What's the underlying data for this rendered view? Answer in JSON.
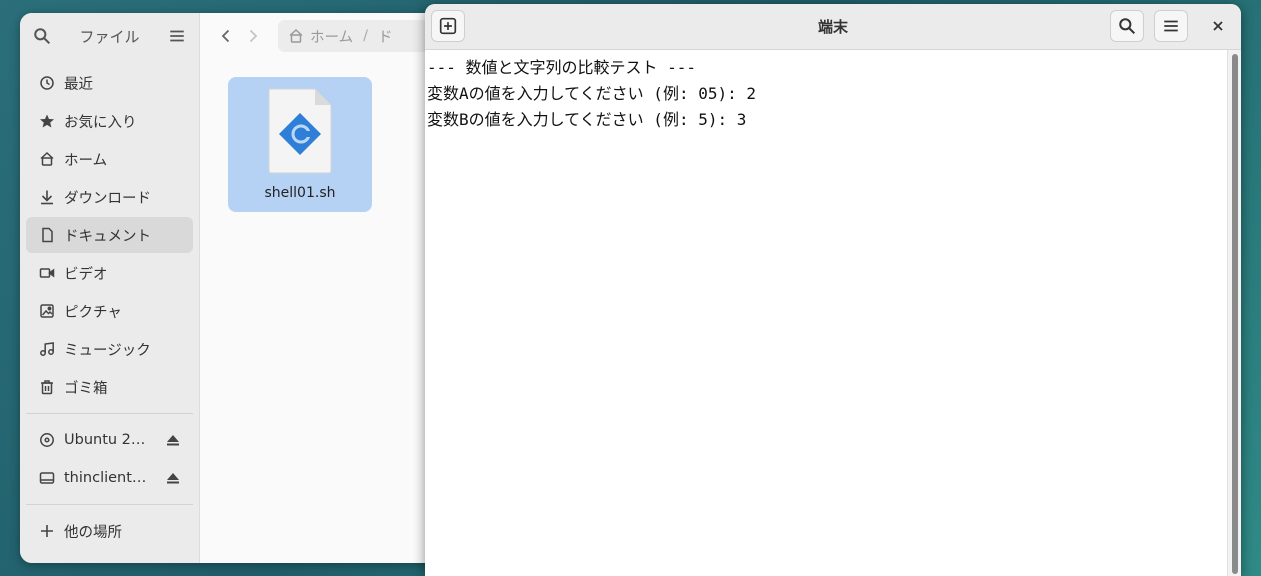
{
  "file_manager": {
    "sidebar_title": "ファイル",
    "places": [
      {
        "label": "最近",
        "icon": "clock-icon"
      },
      {
        "label": "お気に入り",
        "icon": "star-icon"
      },
      {
        "label": "ホーム",
        "icon": "home-icon"
      },
      {
        "label": "ダウンロード",
        "icon": "download-icon"
      },
      {
        "label": "ドキュメント",
        "icon": "document-icon",
        "active": true
      },
      {
        "label": "ビデオ",
        "icon": "video-icon"
      },
      {
        "label": "ピクチャ",
        "icon": "picture-icon"
      },
      {
        "label": "ミュージック",
        "icon": "music-icon"
      },
      {
        "label": "ゴミ箱",
        "icon": "trash-icon"
      }
    ],
    "devices": [
      {
        "label": "Ubuntu 2…",
        "icon": "disc-icon"
      },
      {
        "label": "thinclient…",
        "icon": "drive-icon"
      }
    ],
    "other_locations": "他の場所",
    "path": {
      "home": "ホーム",
      "current": "ド"
    },
    "file": {
      "name": "shell01.sh"
    }
  },
  "terminal": {
    "title": "端末",
    "lines": [
      "--- 数値と文字列の比較テスト ---",
      "変数Aの値を入力してください (例: 05): 2",
      "変数Bの値を入力してください (例: 5): 3"
    ]
  },
  "colors": {
    "desktop": "#2b6f7a",
    "selection": "#b5d2f4",
    "file_icon_accent": "#2f7fd8"
  }
}
